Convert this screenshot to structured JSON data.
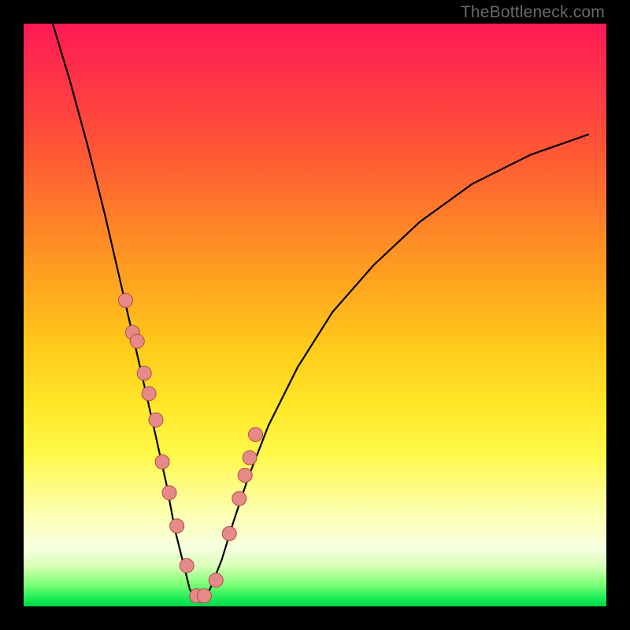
{
  "watermark": "TheBottleneck.com",
  "chart_data": {
    "type": "line",
    "title": "",
    "xlabel": "",
    "ylabel": "",
    "xlim": [
      0,
      1
    ],
    "ylim": [
      0,
      1
    ],
    "series": [
      {
        "name": "curve",
        "x": [
          0.05,
          0.08,
          0.11,
          0.14,
          0.17,
          0.2,
          0.225,
          0.245,
          0.26,
          0.275,
          0.285,
          0.295,
          0.305,
          0.32,
          0.34,
          0.36,
          0.385,
          0.42,
          0.47,
          0.53,
          0.6,
          0.68,
          0.77,
          0.87,
          0.97
        ],
        "y": [
          1.0,
          0.9,
          0.79,
          0.67,
          0.54,
          0.41,
          0.3,
          0.21,
          0.13,
          0.07,
          0.03,
          0.008,
          0.008,
          0.03,
          0.08,
          0.145,
          0.22,
          0.31,
          0.41,
          0.505,
          0.585,
          0.66,
          0.725,
          0.775,
          0.81
        ]
      },
      {
        "name": "dots",
        "x": [
          0.175,
          0.187,
          0.195,
          0.207,
          0.215,
          0.227,
          0.238,
          0.25,
          0.263,
          0.28,
          0.297,
          0.31,
          0.33,
          0.353,
          0.37,
          0.38,
          0.388,
          0.398
        ],
        "y": [
          0.525,
          0.47,
          0.455,
          0.4,
          0.365,
          0.32,
          0.248,
          0.195,
          0.138,
          0.07,
          0.018,
          0.018,
          0.045,
          0.125,
          0.185,
          0.225,
          0.255,
          0.295
        ]
      }
    ],
    "colors": {
      "curve_stroke": "#000000",
      "dot_fill": "#e58a88",
      "dot_stroke": "#b54b48"
    }
  }
}
